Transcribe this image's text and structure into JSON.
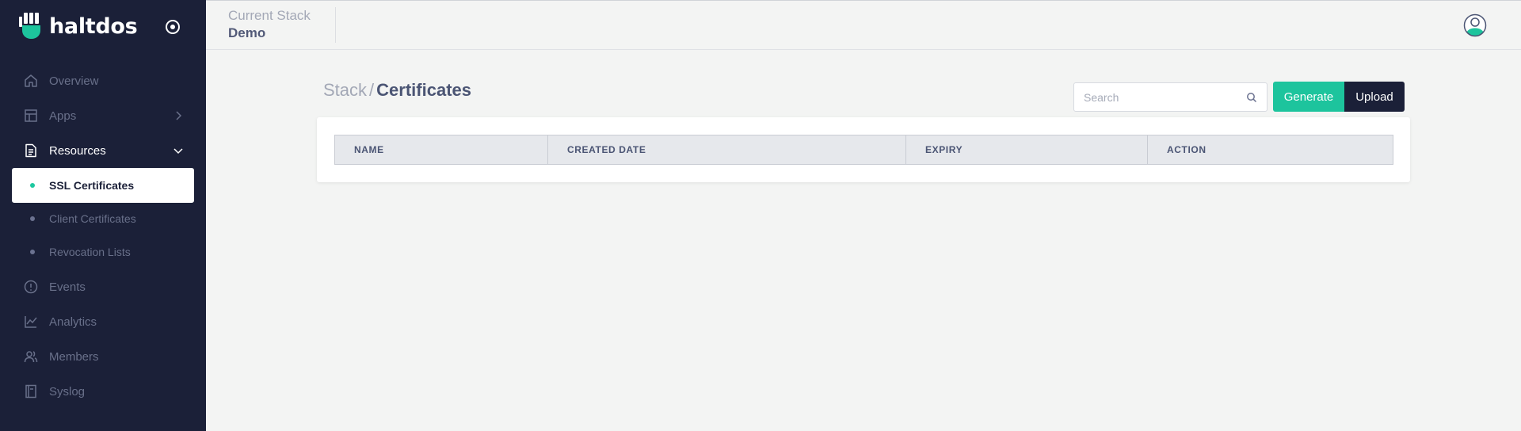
{
  "brand": {
    "name": "haltdos",
    "accent": "#1dc49d"
  },
  "sidebar": {
    "background": "#1b2038",
    "items": [
      {
        "label": "Overview",
        "icon": "home-icon"
      },
      {
        "label": "Apps",
        "icon": "layout-icon",
        "chevron": "chevron-right-icon"
      },
      {
        "label": "Resources",
        "icon": "document-icon",
        "chevron": "chevron-down-icon",
        "active": true
      },
      {
        "label": "Events",
        "icon": "alert-circle-icon"
      },
      {
        "label": "Analytics",
        "icon": "line-chart-icon"
      },
      {
        "label": "Members",
        "icon": "users-icon"
      },
      {
        "label": "Syslog",
        "icon": "book-icon"
      }
    ],
    "subitems": [
      {
        "label": "SSL Certificates",
        "active": true
      },
      {
        "label": "Client Certificates"
      },
      {
        "label": "Revocation Lists"
      }
    ]
  },
  "topbar": {
    "stack_label": "Current Stack",
    "stack_name": "Demo"
  },
  "breadcrumb": {
    "parent": "Stack",
    "separator": "/",
    "current": "Certificates"
  },
  "search": {
    "placeholder": "Search"
  },
  "actions": {
    "generate": "Generate",
    "upload": "Upload"
  },
  "table": {
    "columns": [
      "NAME",
      "CREATED DATE",
      "EXPIRY",
      "ACTION"
    ],
    "rows": []
  }
}
